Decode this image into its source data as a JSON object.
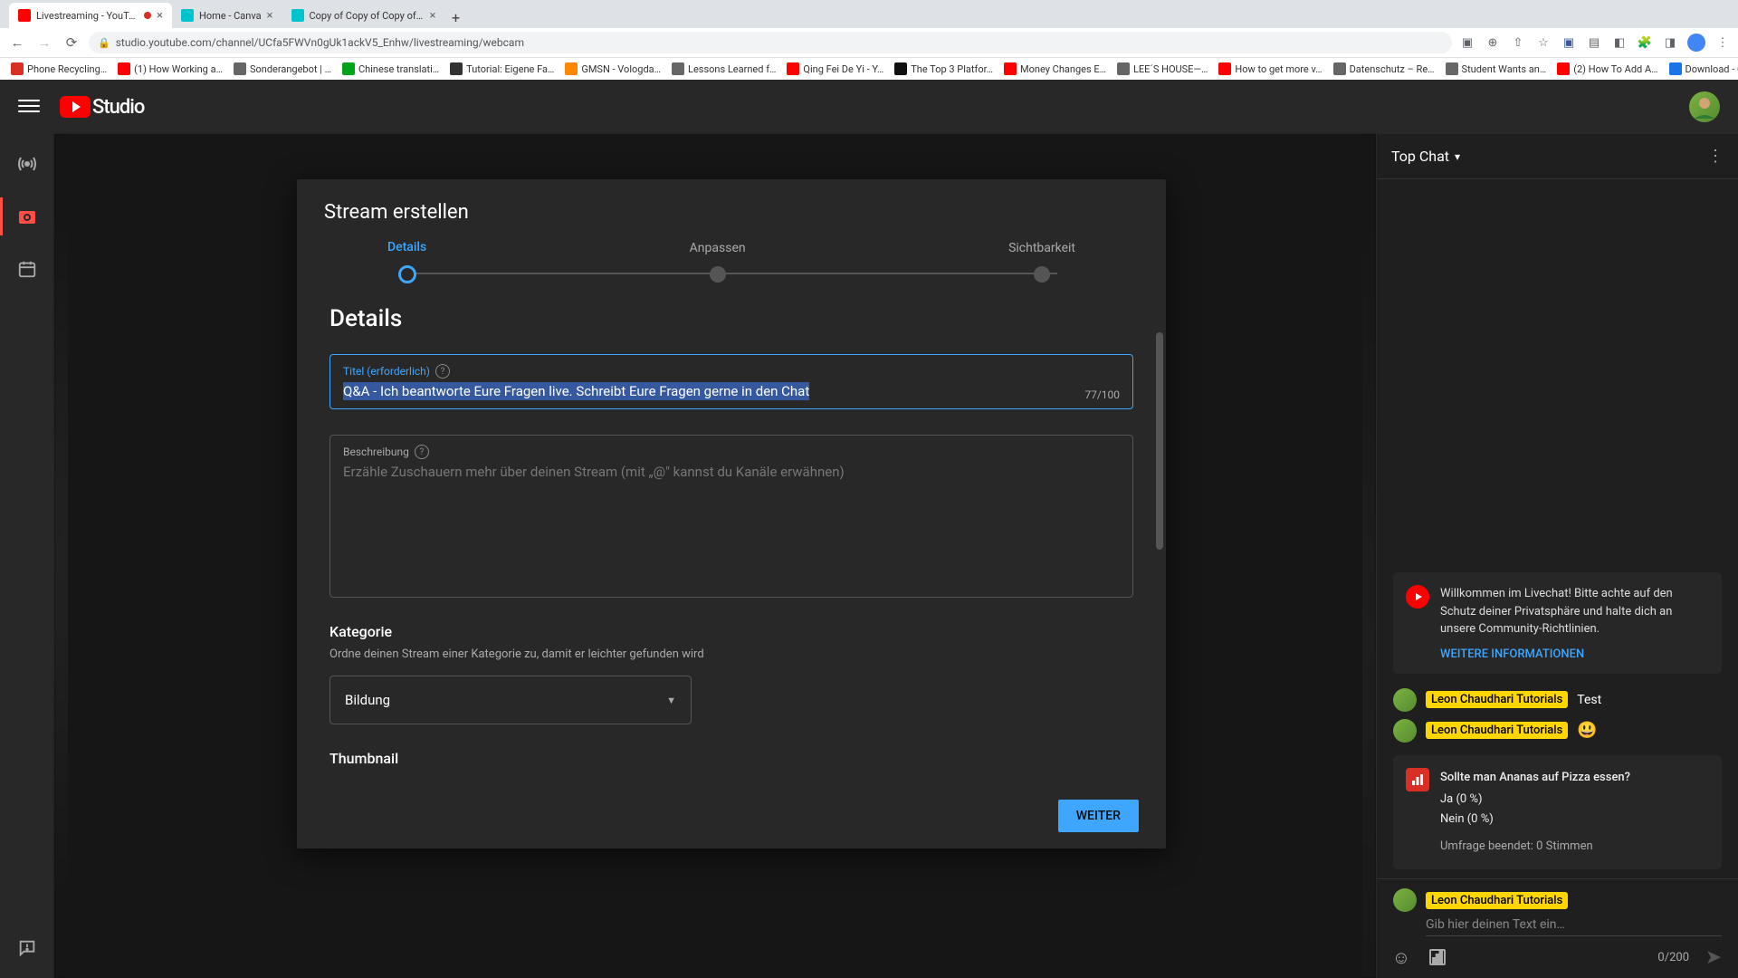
{
  "browser": {
    "tabs": [
      {
        "title": "Livestreaming - YouTube S",
        "active": true,
        "recording": true
      },
      {
        "title": "Home - Canva",
        "active": false
      },
      {
        "title": "Copy of Copy of Copy of Cop",
        "active": false
      }
    ],
    "url": "studio.youtube.com/channel/UCfa5FWVn0gUk1ackV5_Enhw/livestreaming/webcam",
    "bookmarks": [
      {
        "label": "Phone Recycling…",
        "color": "#d93025"
      },
      {
        "label": "(1) How Working a…",
        "color": "#ff0000"
      },
      {
        "label": "Sonderangebot | …",
        "color": "#666"
      },
      {
        "label": "Chinese translati…",
        "color": "#00a319"
      },
      {
        "label": "Tutorial: Eigene Fa…",
        "color": "#333"
      },
      {
        "label": "GMSN - Vologda…",
        "color": "#ff8800"
      },
      {
        "label": "Lessons Learned f…",
        "color": "#666"
      },
      {
        "label": "Qing Fei De Yi - Y…",
        "color": "#ff0000"
      },
      {
        "label": "The Top 3 Platfor…",
        "color": "#111"
      },
      {
        "label": "Money Changes E…",
        "color": "#ff0000"
      },
      {
        "label": "LEE´S HOUSE—…",
        "color": "#666"
      },
      {
        "label": "How to get more v…",
        "color": "#ff0000"
      },
      {
        "label": "Datenschutz – Re…",
        "color": "#666"
      },
      {
        "label": "Student Wants an…",
        "color": "#666"
      },
      {
        "label": "(2) How To Add A…",
        "color": "#ff0000"
      },
      {
        "label": "Download - Cooki…",
        "color": "#1a73e8"
      }
    ]
  },
  "header": {
    "studio": "Studio"
  },
  "chat": {
    "title": "Top Chat",
    "welcome": "Willkommen im Livechat! Bitte achte auf den Schutz deiner Privatsphäre und halte dich an unsere Community-Richtlinien.",
    "welcome_link": "WEITERE INFORMATIONEN",
    "author": "Leon Chaudhari Tutorials",
    "msg1": "Test",
    "msg2_emoji": "😃",
    "poll": {
      "question": "Sollte man Ananas auf Pizza essen?",
      "opt1": "Ja (0 %)",
      "opt2": "Nein (0 %)",
      "ended": "Umfrage beendet: 0 Stimmen"
    },
    "input_placeholder": "Gib hier deinen Text ein…",
    "char": "0/200"
  },
  "modal": {
    "title": "Stream erstellen",
    "steps": [
      "Details",
      "Anpassen",
      "Sichtbarkeit"
    ],
    "section": "Details",
    "title_field_label": "Titel (erforderlich)",
    "title_value": "Q&A - Ich beantworte Eure Fragen live. Schreibt Eure Fragen gerne in den Chat",
    "title_count": "77/100",
    "desc_label": "Beschreibung",
    "desc_placeholder": "Erzähle Zuschauern mehr über deinen Stream (mit „@\" kannst du Kanäle erwähnen)",
    "category_title": "Kategorie",
    "category_sub": "Ordne deinen Stream einer Kategorie zu, damit er leichter gefunden wird",
    "category_value": "Bildung",
    "thumbnail_title": "Thumbnail",
    "next": "WEITER"
  }
}
